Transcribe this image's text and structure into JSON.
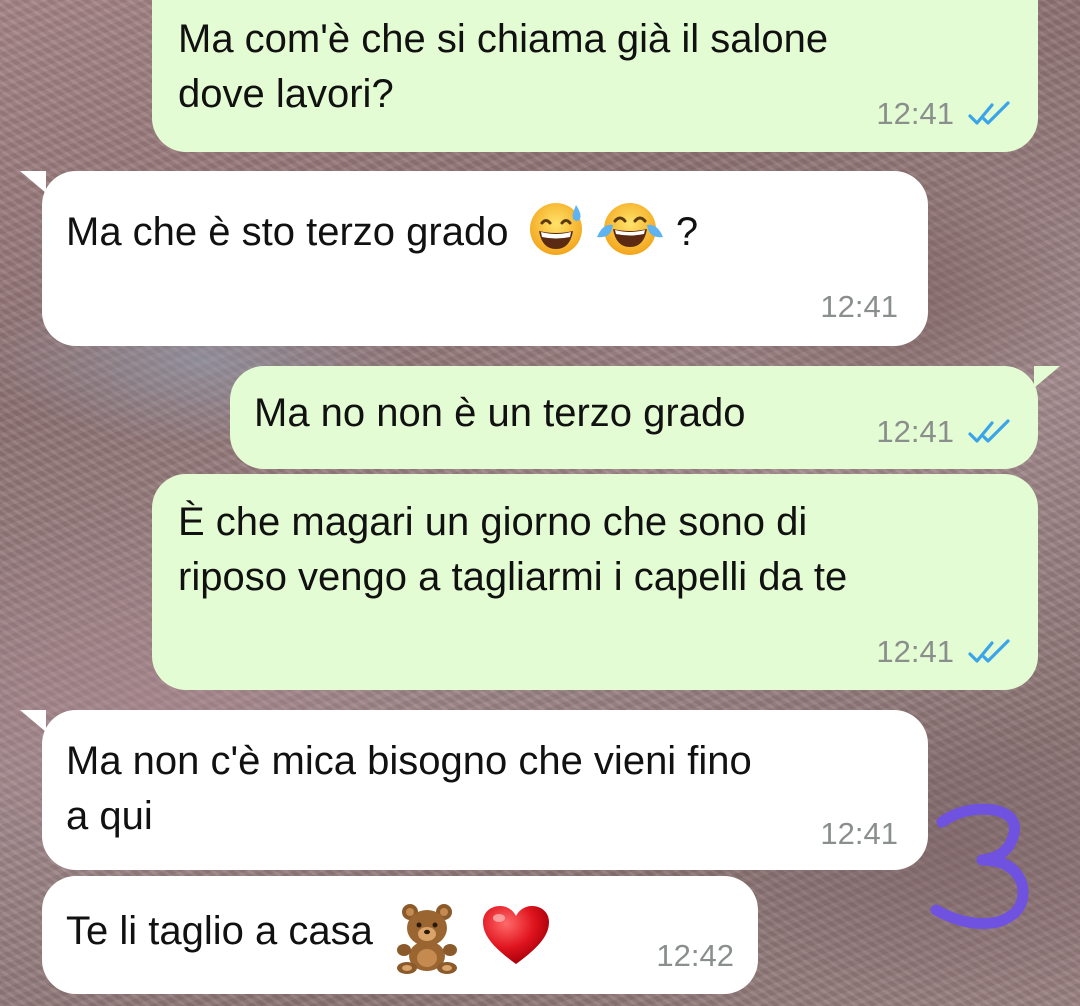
{
  "chat": {
    "messages": [
      {
        "direction": "outgoing",
        "text_line1": "Ma com'è che si chiama già il salone",
        "text_line2": "dove lavori?",
        "time": "12:41",
        "status": "read"
      },
      {
        "direction": "incoming",
        "text": "Ma che è sto terzo grado",
        "emojis": [
          "grinning-sweat-emoji",
          "tears-of-joy-emoji"
        ],
        "text_suffix": "?",
        "time": "12:41"
      },
      {
        "direction": "outgoing",
        "text": "Ma no non è un terzo grado",
        "time": "12:41",
        "status": "read"
      },
      {
        "direction": "outgoing",
        "text_line1": "È che magari un giorno che sono di",
        "text_line2": "riposo vengo a tagliarmi i capelli da te",
        "time": "12:41",
        "status": "read"
      },
      {
        "direction": "incoming",
        "text_line1": "Ma non c'è mica bisogno che vieni fino",
        "text_line2": "a qui",
        "time": "12:41"
      },
      {
        "direction": "incoming",
        "text": "Te li taglio a casa",
        "emojis": [
          "teddy-bear-emoji",
          "red-heart-emoji"
        ],
        "time": "12:42"
      }
    ]
  },
  "annotation": {
    "text": "3",
    "color": "#6f52e0"
  },
  "colors": {
    "outgoing_bubble": "#e4fcd3",
    "incoming_bubble": "#ffffff",
    "read_check": "#3aa4e8",
    "timestamp": "#8a8f8d"
  }
}
